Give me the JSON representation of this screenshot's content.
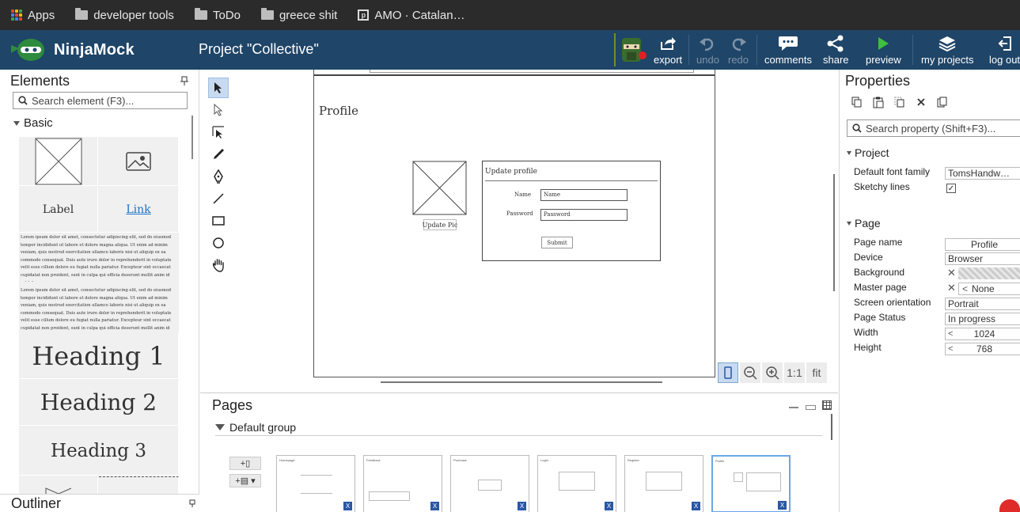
{
  "bookmarks": [
    {
      "label": "Apps",
      "icon": "apps-grid-icon"
    },
    {
      "label": "developer tools",
      "icon": "folder-icon"
    },
    {
      "label": "ToDo",
      "icon": "folder-icon"
    },
    {
      "label": "greece shit",
      "icon": "folder-icon"
    },
    {
      "label": "AMO · Catalan…",
      "icon": "amo-icon"
    }
  ],
  "app": {
    "name": "NinjaMock",
    "project_title": "Project \"Collective\"",
    "accent": "#1f4568"
  },
  "toolbar": {
    "export": "export",
    "undo": "undo",
    "redo": "redo",
    "comments": "comments",
    "share": "share",
    "preview": "preview",
    "my_projects": "my projects",
    "logout": "log out"
  },
  "elements_panel": {
    "title": "Elements",
    "search_placeholder": "Search element (F3)...",
    "group": "Basic",
    "label_sample": "Label",
    "link_sample": "Link",
    "lorem": "Lorem ipsum dolor sit amet, consectetur adipiscing elit, sed do eiusmod tempor incididunt ut labore et dolore magna aliqua. Ut enim ad minim veniam, quis nostrud exercitation ullamco laboris nisi ut aliquip ex ea commodo consequat. Duis aute irure dolor in reprehenderit in voluptate velit esse cillum dolore eu fugiat nulla pariatur. Excepteur sint occaecat cupidatat non proident, sunt in culpa qui officia deserunt mollit anim id est laborum",
    "heading1": "Heading 1",
    "heading2": "Heading 2",
    "heading3": "Heading 3"
  },
  "outliner": {
    "title": "Outliner"
  },
  "mockup": {
    "page_heading": "Profile",
    "update_pic": "Update Pic",
    "form_title": "Update profile",
    "name_label": "Name",
    "name_value": "Name",
    "password_label": "Password",
    "password_value": "Password",
    "submit": "Submit"
  },
  "zoom": {
    "one_to_one": "1:1",
    "fit": "fit"
  },
  "pages_panel": {
    "title": "Pages",
    "group": "Default group",
    "thumbnails": [
      {
        "name": "Homepage",
        "selected": false
      },
      {
        "name": "Feedback",
        "selected": false
      },
      {
        "name": "Purchase",
        "selected": false
      },
      {
        "name": "Login",
        "selected": false
      },
      {
        "name": "Register",
        "selected": false
      },
      {
        "name": "Profile",
        "selected": true
      }
    ]
  },
  "properties": {
    "title": "Properties",
    "search_placeholder": "Search property (Shift+F3)...",
    "project_section": "Project",
    "default_font_family_label": "Default font family",
    "default_font_family_value": "TomsHandw…",
    "sketchy_lines_label": "Sketchy lines",
    "sketchy_lines_checked": true,
    "page_section": "Page",
    "page_name_label": "Page name",
    "page_name_value": "Profile",
    "device_label": "Device",
    "device_value": "Browser",
    "background_label": "Background",
    "master_page_label": "Master page",
    "master_page_value": "None",
    "screen_orientation_label": "Screen orientation",
    "screen_orientation_value": "Portrait",
    "page_status_label": "Page Status",
    "page_status_value": "In progress",
    "width_label": "Width",
    "width_value": "1024",
    "height_label": "Height",
    "height_value": "768"
  }
}
